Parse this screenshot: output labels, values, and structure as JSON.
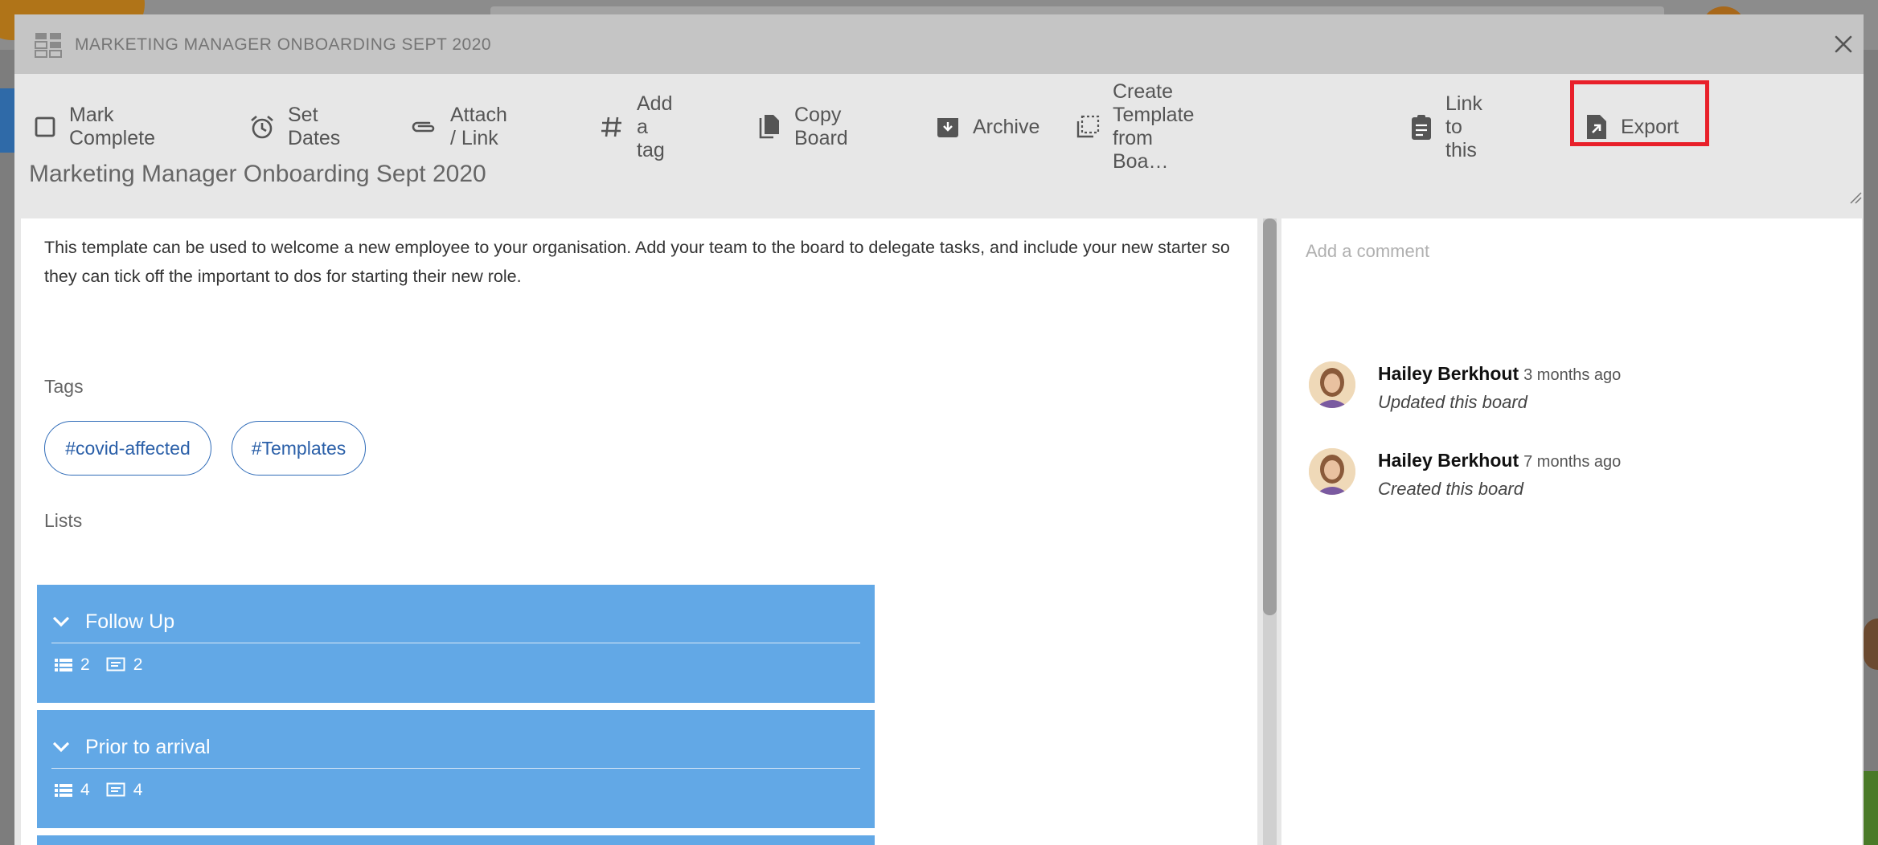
{
  "modal": {
    "header_title": "MARKETING MANAGER ONBOARDING SEPT 2020",
    "board_name": "Marketing Manager Onboarding Sept 2020"
  },
  "toolbar": {
    "items": [
      {
        "label": "Mark Complete",
        "icon": "checkbox-icon"
      },
      {
        "label": "Set Dates",
        "icon": "alarm-clock-icon"
      },
      {
        "label": "Attach / Link",
        "icon": "paperclip-icon"
      },
      {
        "label": "Add a tag",
        "icon": "hashtag-icon"
      },
      {
        "label": "Copy Board",
        "icon": "copy-icon"
      },
      {
        "label": "Archive",
        "icon": "archive-icon"
      },
      {
        "label": "Create Template from Boa…",
        "icon": "template-icon"
      },
      {
        "label": "Link to this",
        "icon": "clipboard-icon"
      },
      {
        "label": "Export",
        "icon": "export-icon"
      }
    ]
  },
  "description": "This template can be used to welcome a new employee to your organisation. Add your team to the board to delegate tasks, and include your new starter so they can tick off the important to dos for starting their new role.",
  "tags": {
    "label": "Tags",
    "items": [
      "#covid-affected",
      "#Templates"
    ]
  },
  "lists": {
    "label": "Lists",
    "items": [
      {
        "title": "Follow Up",
        "task_count": "2",
        "comment_count": "2"
      },
      {
        "title": "Prior to arrival",
        "task_count": "4",
        "comment_count": "4"
      }
    ]
  },
  "comments": {
    "placeholder": "Add a comment",
    "activity": [
      {
        "user": "Hailey Berkhout",
        "time": "3 months ago",
        "action": "Updated this board"
      },
      {
        "user": "Hailey Berkhout",
        "time": "7 months ago",
        "action": "Created this board"
      }
    ]
  },
  "colors": {
    "list_card": "#62a8e6",
    "tag_border": "#2f6bb8",
    "highlight": "#e8202a"
  }
}
